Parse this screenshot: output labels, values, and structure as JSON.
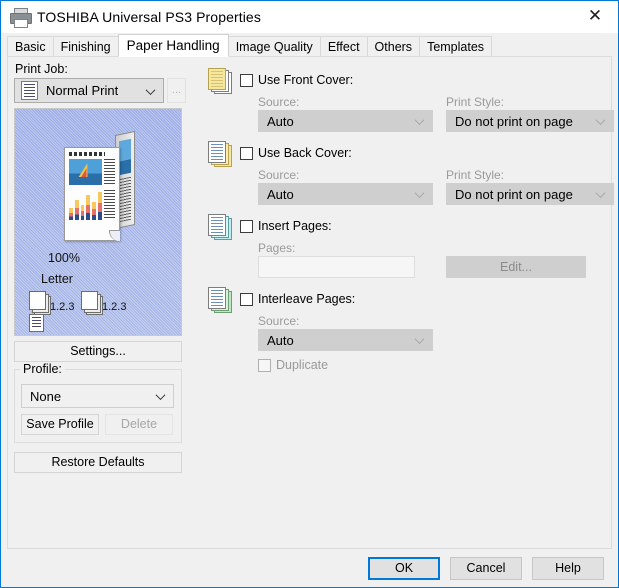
{
  "window": {
    "title": "TOSHIBA Universal PS3 Properties",
    "icon": "printer-icon",
    "close_label": "✕",
    "accent_color": "#0078d7"
  },
  "tabs": [
    {
      "label": "Basic",
      "active": false
    },
    {
      "label": "Finishing",
      "active": false
    },
    {
      "label": "Paper Handling",
      "active": true
    },
    {
      "label": "Image Quality",
      "active": false
    },
    {
      "label": "Effect",
      "active": false
    },
    {
      "label": "Others",
      "active": false
    },
    {
      "label": "Templates",
      "active": false
    }
  ],
  "left_panel": {
    "print_job_label": "Print Job:",
    "print_job_value": "Normal Print",
    "browse_button_label": "...",
    "preview": {
      "zoom": "100%",
      "paper_size": "Letter",
      "stack_left_label": "1.2.3",
      "stack_right_label": "1.2.3"
    },
    "settings_button": "Settings...",
    "profile_group_label": "Profile:",
    "profile_value": "None",
    "save_profile_button": "Save Profile",
    "delete_button": "Delete",
    "restore_defaults_button": "Restore Defaults"
  },
  "paper_handling": {
    "front_cover": {
      "checkbox_label": "Use Front Cover:",
      "checked": false,
      "source_label": "Source:",
      "source_value": "Auto",
      "print_style_label": "Print Style:",
      "print_style_value": "Do not print on page"
    },
    "back_cover": {
      "checkbox_label": "Use Back Cover:",
      "checked": false,
      "source_label": "Source:",
      "source_value": "Auto",
      "print_style_label": "Print Style:",
      "print_style_value": "Do not print on page"
    },
    "insert_pages": {
      "checkbox_label": "Insert Pages:",
      "checked": false,
      "pages_label": "Pages:",
      "pages_value": "",
      "pages_placeholder": "",
      "edit_button": "Edit..."
    },
    "interleave_pages": {
      "checkbox_label": "Interleave Pages:",
      "checked": false,
      "source_label": "Source:",
      "source_value": "Auto",
      "duplicate_label": "Duplicate",
      "duplicate_checked": false
    }
  },
  "footer": {
    "ok": "OK",
    "cancel": "Cancel",
    "help": "Help"
  }
}
